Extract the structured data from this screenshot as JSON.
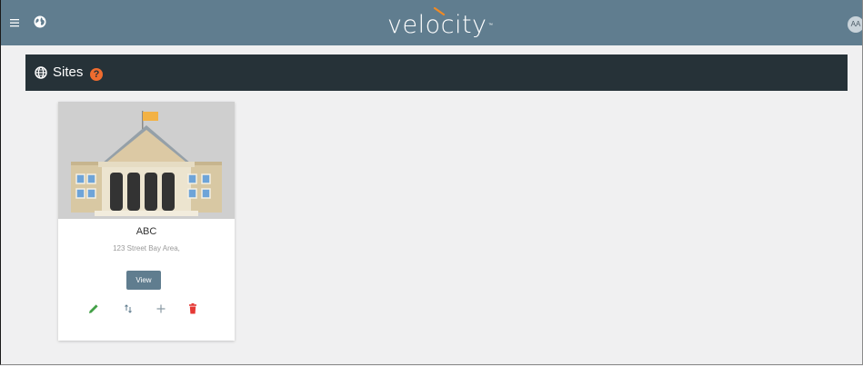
{
  "topbar": {
    "logo_text": "velocity",
    "logo_tm": "™",
    "avatar_initials": "AA",
    "menu_icon": "hamburger-menu-icon",
    "globe_icon": "globe-icon"
  },
  "header": {
    "title": "Sites",
    "help_glyph": "?"
  },
  "site_card": {
    "name": "ABC",
    "address": "123 Street Bay Area,",
    "view_label": "View",
    "actions": [
      "edit-icon",
      "sort-icon",
      "add-icon",
      "delete-icon"
    ]
  },
  "colors": {
    "topbar": "#607d8f",
    "header": "#263238",
    "help": "#ef6c2f",
    "edit": "#43a047",
    "delete": "#e53935",
    "logo_accent": "#f08a24",
    "background": "#f0f0f1"
  }
}
